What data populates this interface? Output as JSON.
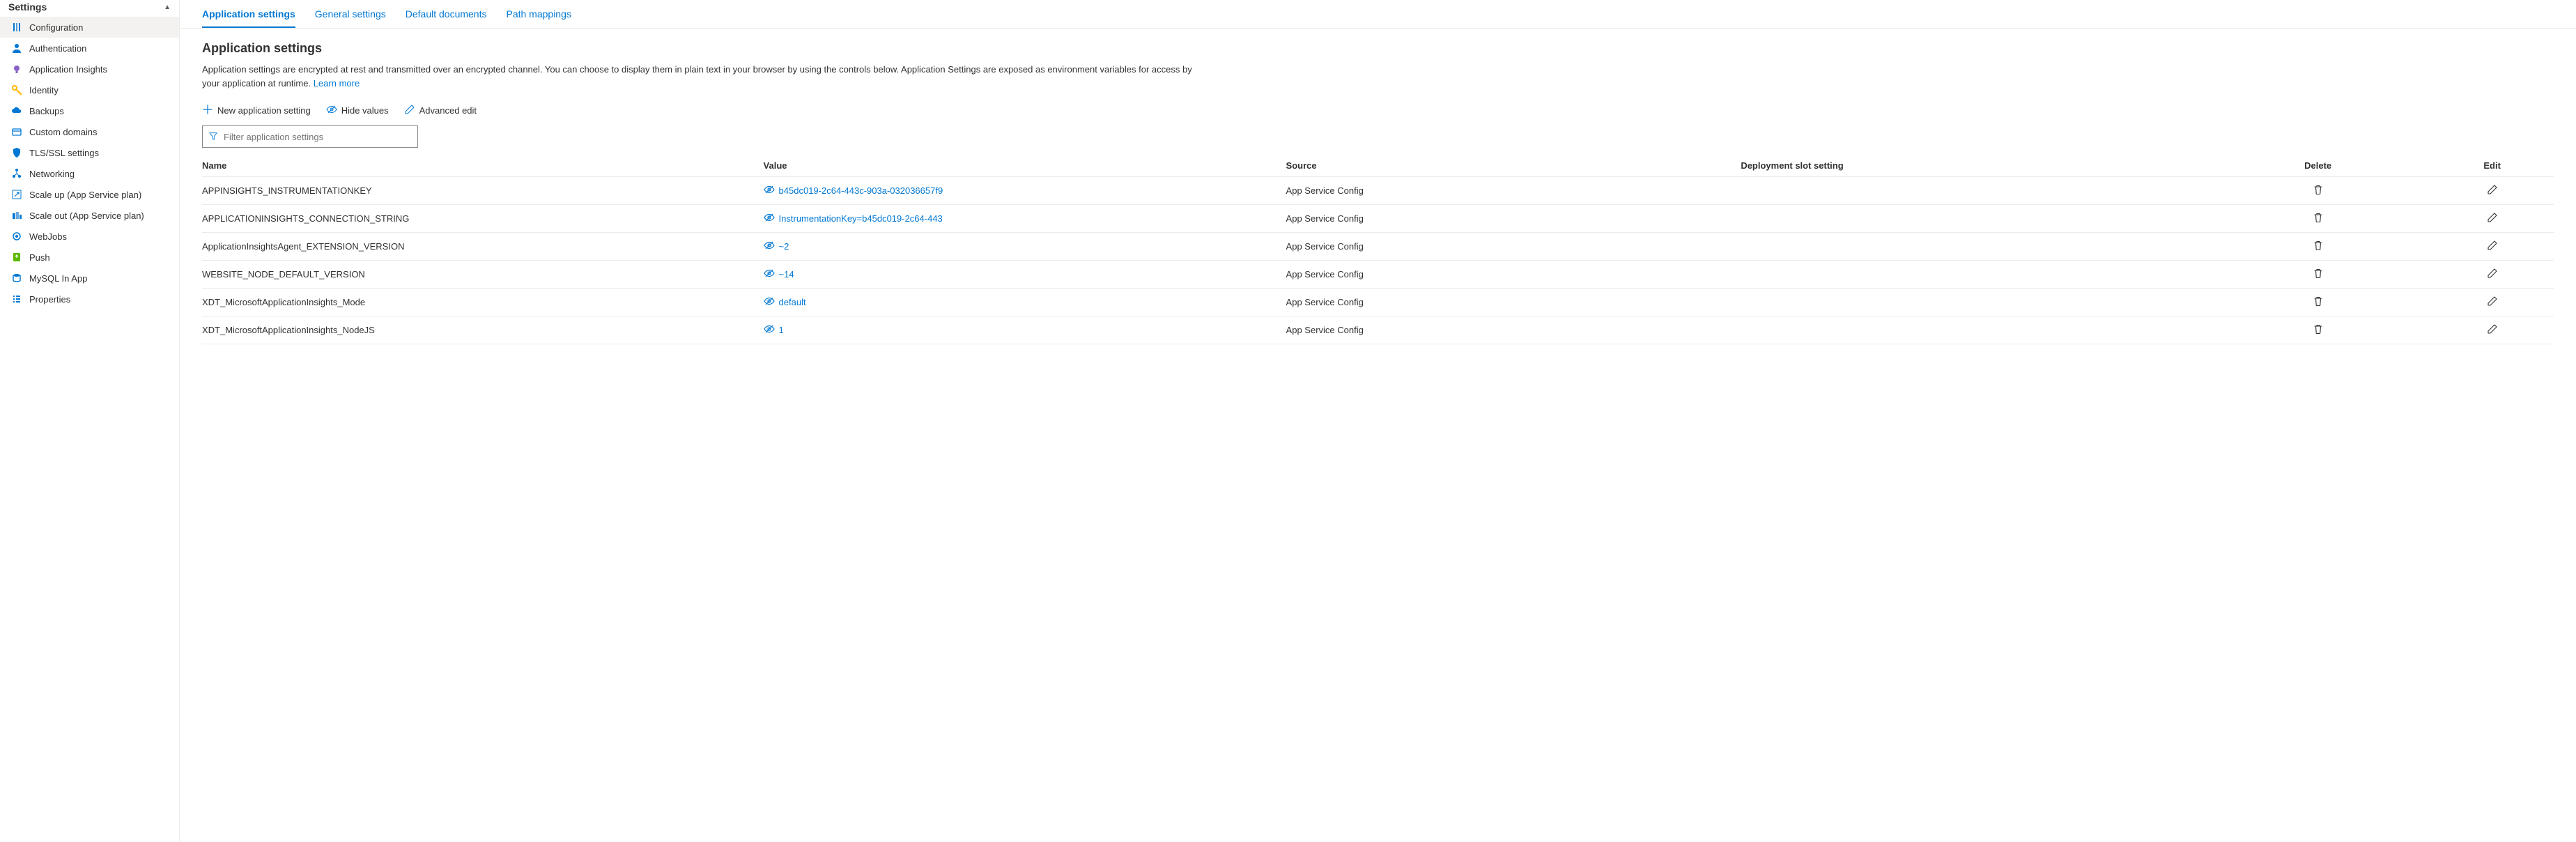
{
  "sidebar": {
    "title": "Settings",
    "items": [
      {
        "label": "Configuration",
        "active": true,
        "icon": "sliders"
      },
      {
        "label": "Authentication",
        "active": false,
        "icon": "person"
      },
      {
        "label": "Application Insights",
        "active": false,
        "icon": "bulb"
      },
      {
        "label": "Identity",
        "active": false,
        "icon": "key"
      },
      {
        "label": "Backups",
        "active": false,
        "icon": "cloud"
      },
      {
        "label": "Custom domains",
        "active": false,
        "icon": "domain"
      },
      {
        "label": "TLS/SSL settings",
        "active": false,
        "icon": "shield"
      },
      {
        "label": "Networking",
        "active": false,
        "icon": "network"
      },
      {
        "label": "Scale up (App Service plan)",
        "active": false,
        "icon": "scaleup"
      },
      {
        "label": "Scale out (App Service plan)",
        "active": false,
        "icon": "scaleout"
      },
      {
        "label": "WebJobs",
        "active": false,
        "icon": "gear"
      },
      {
        "label": "Push",
        "active": false,
        "icon": "push"
      },
      {
        "label": "MySQL In App",
        "active": false,
        "icon": "mysql"
      },
      {
        "label": "Properties",
        "active": false,
        "icon": "properties"
      }
    ]
  },
  "tabs": [
    {
      "label": "Application settings",
      "active": true
    },
    {
      "label": "General settings",
      "active": false
    },
    {
      "label": "Default documents",
      "active": false
    },
    {
      "label": "Path mappings",
      "active": false
    }
  ],
  "section": {
    "title": "Application settings",
    "description": "Application settings are encrypted at rest and transmitted over an encrypted channel. You can choose to display them in plain text in your browser by using the controls below. Application Settings are exposed as environment variables for access by your application at runtime. ",
    "learn_more": "Learn more"
  },
  "toolbar": {
    "new_setting": "New application setting",
    "hide_values": "Hide values",
    "advanced_edit": "Advanced edit"
  },
  "filter": {
    "placeholder": "Filter application settings"
  },
  "table": {
    "headers": {
      "name": "Name",
      "value": "Value",
      "source": "Source",
      "slot": "Deployment slot setting",
      "delete": "Delete",
      "edit": "Edit"
    },
    "rows": [
      {
        "name": "APPINSIGHTS_INSTRUMENTATIONKEY",
        "value": "b45dc019-2c64-443c-903a-032036657f9",
        "source": "App Service Config"
      },
      {
        "name": "APPLICATIONINSIGHTS_CONNECTION_STRING",
        "value": "InstrumentationKey=b45dc019-2c64-443",
        "source": "App Service Config"
      },
      {
        "name": "ApplicationInsightsAgent_EXTENSION_VERSION",
        "value": "~2",
        "source": "App Service Config"
      },
      {
        "name": "WEBSITE_NODE_DEFAULT_VERSION",
        "value": "~14",
        "source": "App Service Config"
      },
      {
        "name": "XDT_MicrosoftApplicationInsights_Mode",
        "value": "default",
        "source": "App Service Config"
      },
      {
        "name": "XDT_MicrosoftApplicationInsights_NodeJS",
        "value": "1",
        "source": "App Service Config"
      }
    ]
  }
}
